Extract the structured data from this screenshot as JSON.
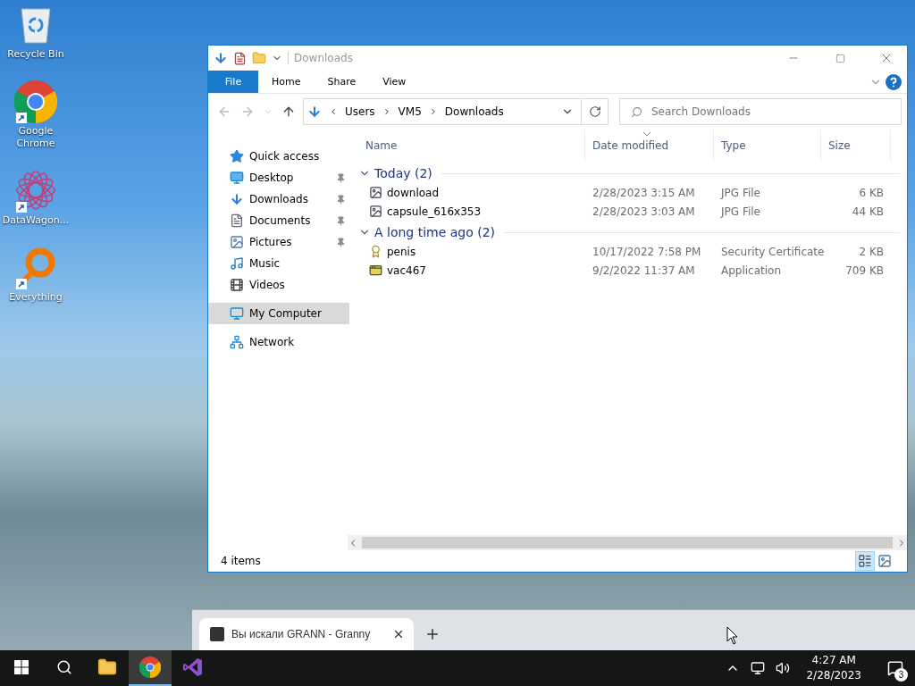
{
  "desktop_icons": [
    {
      "label": "Recycle Bin",
      "kind": "recycle",
      "shortcut": false
    },
    {
      "label": "Google Chrome",
      "kind": "chrome",
      "shortcut": true
    },
    {
      "label": "DataWagon...",
      "kind": "datawagon",
      "shortcut": true
    },
    {
      "label": "Everything",
      "kind": "everything",
      "shortcut": true
    }
  ],
  "explorer": {
    "title": "Downloads",
    "ribbon_tabs": [
      {
        "label": "File",
        "selected": true
      },
      {
        "label": "Home",
        "selected": false
      },
      {
        "label": "Share",
        "selected": false
      },
      {
        "label": "View",
        "selected": false
      }
    ],
    "breadcrumb": [
      "Users",
      "VM5",
      "Downloads"
    ],
    "search": {
      "placeholder": "Search Downloads"
    },
    "nav_items": [
      {
        "label": "Quick access",
        "kind": "quick",
        "pinned": false,
        "selected": false
      },
      {
        "label": "Desktop",
        "kind": "desktop",
        "pinned": true,
        "selected": false
      },
      {
        "label": "Downloads",
        "kind": "downloads",
        "pinned": true,
        "selected": false
      },
      {
        "label": "Documents",
        "kind": "documents",
        "pinned": true,
        "selected": false
      },
      {
        "label": "Pictures",
        "kind": "pictures",
        "pinned": true,
        "selected": false
      },
      {
        "label": "Music",
        "kind": "music",
        "pinned": false,
        "selected": false
      },
      {
        "label": "Videos",
        "kind": "videos",
        "pinned": false,
        "selected": false
      },
      {
        "label": "My Computer",
        "kind": "computer",
        "pinned": false,
        "selected": true
      },
      {
        "label": "Network",
        "kind": "network",
        "pinned": false,
        "selected": false
      }
    ],
    "columns": [
      {
        "label": "Name",
        "sorted": false
      },
      {
        "label": "Date modified",
        "sorted": true
      },
      {
        "label": "Type",
        "sorted": false
      },
      {
        "label": "Size",
        "sorted": false
      }
    ],
    "groups": [
      {
        "title": "Today (2)",
        "expanded": true,
        "files": [
          {
            "name": "download",
            "date": "2/28/2023 3:15 AM",
            "type": "JPG File",
            "size": "6 KB",
            "kind": "image"
          },
          {
            "name": "capsule_616x353",
            "date": "2/28/2023 3:03 AM",
            "type": "JPG File",
            "size": "44 KB",
            "kind": "image"
          }
        ]
      },
      {
        "title": "A long time ago (2)",
        "expanded": true,
        "files": [
          {
            "name": "penis",
            "date": "10/17/2022 7:58 PM",
            "type": "Security Certificate",
            "size": "2 KB",
            "kind": "certificate"
          },
          {
            "name": "vac467",
            "date": "9/2/2022 11:37 AM",
            "type": "Application",
            "size": "709 KB",
            "kind": "application"
          }
        ]
      }
    ],
    "status": "4 items"
  },
  "browser_tab": {
    "title": "Вы искали GRANN - Granny"
  },
  "taskbar": {
    "apps": [
      {
        "kind": "explorer",
        "selected": false
      },
      {
        "kind": "chrome",
        "selected": true
      },
      {
        "kind": "visualstudio",
        "selected": false
      }
    ],
    "time": "4:27 AM",
    "date": "2/28/2023",
    "notifications": "3"
  }
}
